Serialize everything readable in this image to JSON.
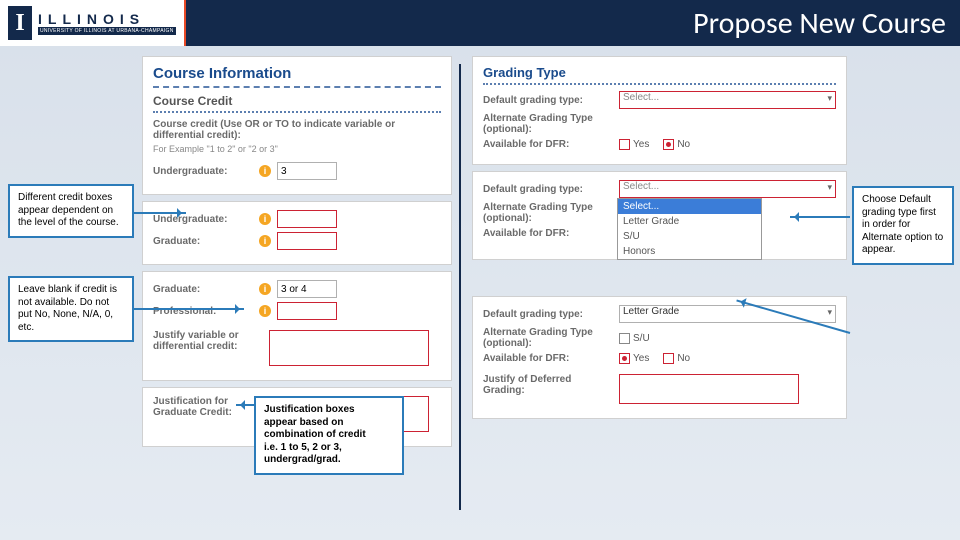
{
  "header": {
    "logo_letter": "I",
    "logo_word": "ILLINOIS",
    "logo_sub": "UNIVERSITY OF ILLINOIS AT URBANA-CHAMPAIGN",
    "title": "Propose New Course"
  },
  "left": {
    "section_title": "Course Information",
    "subsection": "Course Credit",
    "credit_label": "Course credit (Use OR or TO to indicate variable or differential credit):",
    "credit_hint": "For Example \"1 to 2\" or \"2 or 3\"",
    "rows": {
      "undergrad": "Undergraduate:",
      "grad": "Graduate:",
      "prof": "Professional:",
      "justify_var": "Justify variable or differential credit:",
      "justify_grad": "Justification for Graduate Credit:"
    },
    "values": {
      "undergrad_1": "3",
      "grad_val": "3 or 4"
    }
  },
  "right": {
    "section_title": "Grading Type",
    "rows": {
      "default": "Default grading type:",
      "alt": "Alternate Grading Type (optional):",
      "dfr": "Available for DFR:",
      "justify_dfr": "Justify of Deferred Grading:"
    },
    "select_placeholder": "Select...",
    "options": [
      "Select...",
      "Letter Grade",
      "S/U",
      "Honors"
    ],
    "letter_grade": "Letter Grade",
    "su": "S/U",
    "yes": "Yes",
    "no": "No"
  },
  "callouts": {
    "c1": "Different credit boxes appear dependent on the level of the course.",
    "c2": "Leave blank if credit is not available. Do not put No, None, N/A, 0, etc.",
    "c3_lines": [
      "Justification boxes",
      "appear based on",
      "combination of credit",
      "i.e. 1 to 5, 2 or 3,",
      "undergrad/grad."
    ],
    "c4": "Choose Default grading type first in order for Alternate option to appear."
  }
}
